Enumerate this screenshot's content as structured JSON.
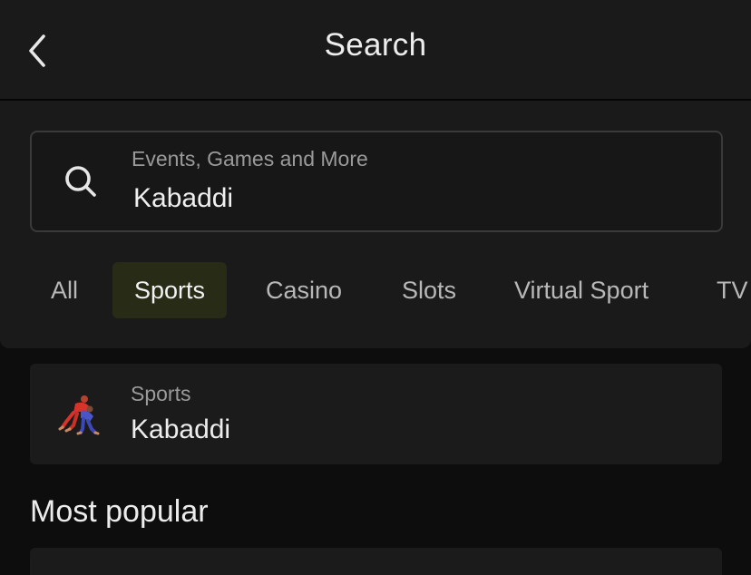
{
  "header": {
    "title": "Search",
    "back_icon": "chevron-left-icon"
  },
  "search": {
    "placeholder": "Events, Games and More",
    "value": "Kabaddi",
    "icon": "search-icon"
  },
  "tabs": [
    {
      "label": "All",
      "active": false
    },
    {
      "label": "Sports",
      "active": true
    },
    {
      "label": "Casino",
      "active": false
    },
    {
      "label": "Slots",
      "active": false
    },
    {
      "label": "Virtual Sport",
      "active": false
    },
    {
      "label": "TV",
      "active": false
    }
  ],
  "results": [
    {
      "category": "Sports",
      "title": "Kabaddi",
      "icon": "kabaddi-icon"
    }
  ],
  "popular": {
    "title": "Most popular"
  },
  "colors": {
    "background": "#0d0d0d",
    "panel": "#1a1a1a",
    "active_tab": "#282c17",
    "text_primary": "#ededed",
    "text_secondary": "#9a9a9a"
  }
}
